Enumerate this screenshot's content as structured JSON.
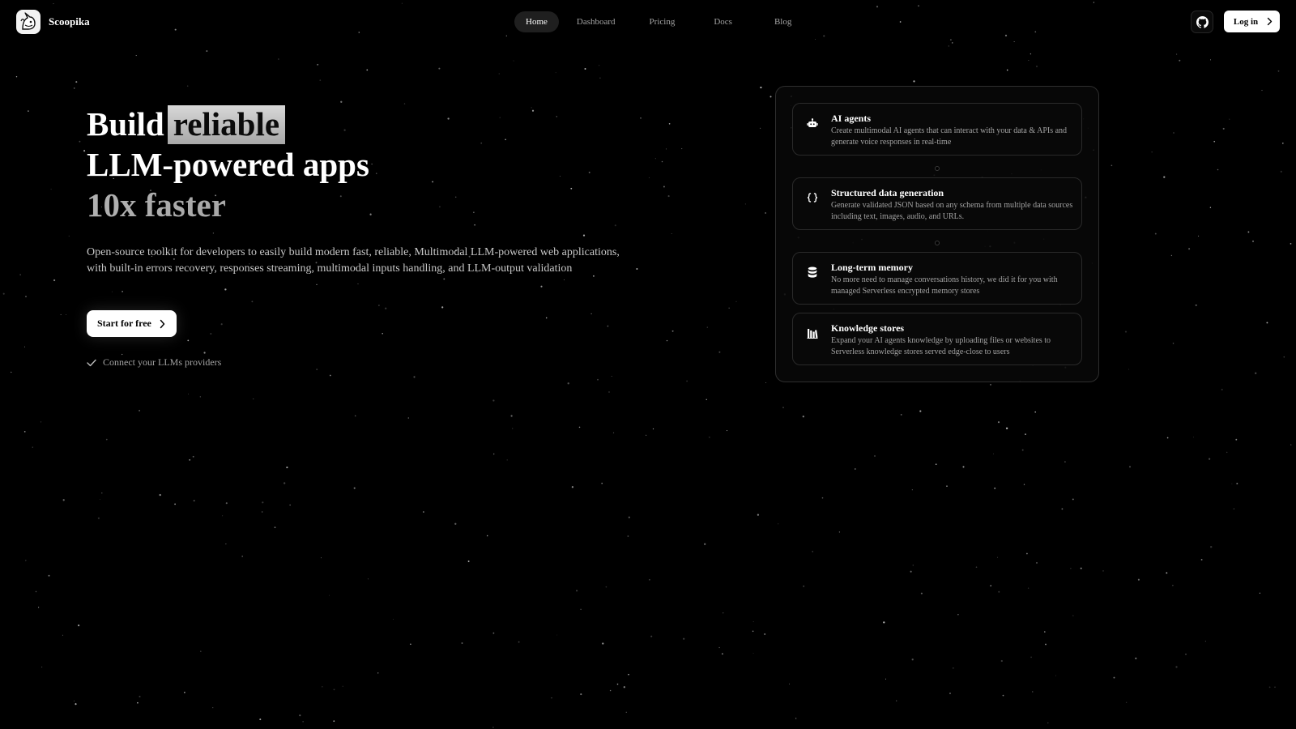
{
  "brand": {
    "name": "Scoopika"
  },
  "nav": {
    "items": [
      {
        "label": "Home",
        "active": true
      },
      {
        "label": "Dashboard",
        "active": false
      },
      {
        "label": "Pricing",
        "active": false
      },
      {
        "label": "Docs",
        "active": false
      },
      {
        "label": "Blog",
        "active": false
      }
    ],
    "login_label": "Log in"
  },
  "hero": {
    "line1_prefix": "Build",
    "line1_highlight": "reliable",
    "line2": "LLM-powered apps",
    "line3": "10x faster",
    "description": "Open-source toolkit for developers to easily build modern fast, reliable, Multimodal LLM-powered web applications, with built-in errors recovery, responses streaming, multimodal inputs handling, and LLM-output validation",
    "cta_label": "Start for free",
    "check_text": "Connect your LLMs providers"
  },
  "features": [
    {
      "icon": "robot-icon",
      "title": "AI agents",
      "description": "Create multimodal AI agents that can interact with your data & APIs and generate voice responses in real-time"
    },
    {
      "icon": "braces-icon",
      "title": "Structured data generation",
      "description": "Generate validated JSON based on any schema from multiple data sources including text, images, audio, and URLs."
    },
    {
      "icon": "database-icon",
      "title": "Long-term memory",
      "description": "No more need to manage conversations history, we did it for you with managed Serverless encrypted memory stores"
    },
    {
      "icon": "library-icon",
      "title": "Knowledge stores",
      "description": "Expand your AI agents knowledge by uploading files or websites to Serverless knowledge stores served edge-close to users"
    }
  ],
  "colors": {
    "background": "#000000",
    "text": "#ffffff",
    "muted": "#a3a3a3",
    "border": "#2a2a2a",
    "highlight": "#c0c0c0"
  }
}
